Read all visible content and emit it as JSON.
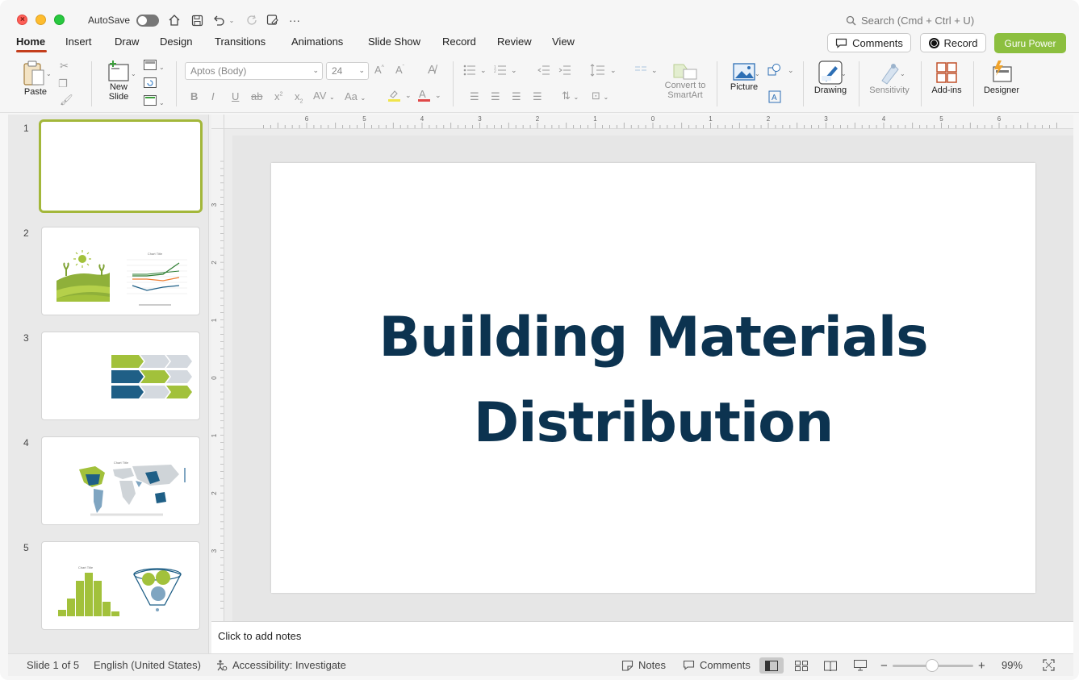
{
  "titlebar": {
    "autosave_label": "AutoSave",
    "search_placeholder": "Search (Cmd + Ctrl + U)"
  },
  "tabs": [
    {
      "label": "Home",
      "active": true
    },
    {
      "label": "Insert"
    },
    {
      "label": "Draw"
    },
    {
      "label": "Design"
    },
    {
      "label": "Transitions"
    },
    {
      "label": "Animations"
    },
    {
      "label": "Slide Show"
    },
    {
      "label": "Record"
    },
    {
      "label": "Review"
    },
    {
      "label": "View"
    }
  ],
  "header_buttons": {
    "comments": "Comments",
    "record": "Record",
    "guru": "Guru Power"
  },
  "ribbon": {
    "paste": "Paste",
    "new_slide_1": "New",
    "new_slide_2": "Slide",
    "font_name": "Aptos (Body)",
    "font_size": "24",
    "convert_1": "Convert to",
    "convert_2": "SmartArt",
    "picture": "Picture",
    "drawing": "Drawing",
    "sensitivity": "Sensitivity",
    "addins": "Add-ins",
    "designer": "Designer"
  },
  "thumbnails": [
    "1",
    "2",
    "3",
    "4",
    "5"
  ],
  "thumb_text": {
    "chart_title": "Chart Title"
  },
  "slide": {
    "title_line1": "Building Materials",
    "title_line2": "Distribution"
  },
  "ruler": {
    "h_labels": [
      "6",
      "5",
      "4",
      "3",
      "2",
      "1",
      "0",
      "1",
      "2",
      "3",
      "4",
      "5",
      "6"
    ],
    "v_labels": [
      "3",
      "2",
      "1",
      "0",
      "1",
      "2",
      "3"
    ]
  },
  "notes": {
    "placeholder": "Click to add notes"
  },
  "status": {
    "slide_of": "Slide 1 of 5",
    "language": "English (United States)",
    "accessibility": "Accessibility: Investigate",
    "notes": "Notes",
    "comments": "Comments",
    "zoom": "99%"
  },
  "colors": {
    "brand_green": "#8cbf3f",
    "title_navy": "#0c3350",
    "accent_orange": "#c43e1c",
    "chart_blue": "#1f5f86",
    "chart_lime": "#a2c13b"
  }
}
